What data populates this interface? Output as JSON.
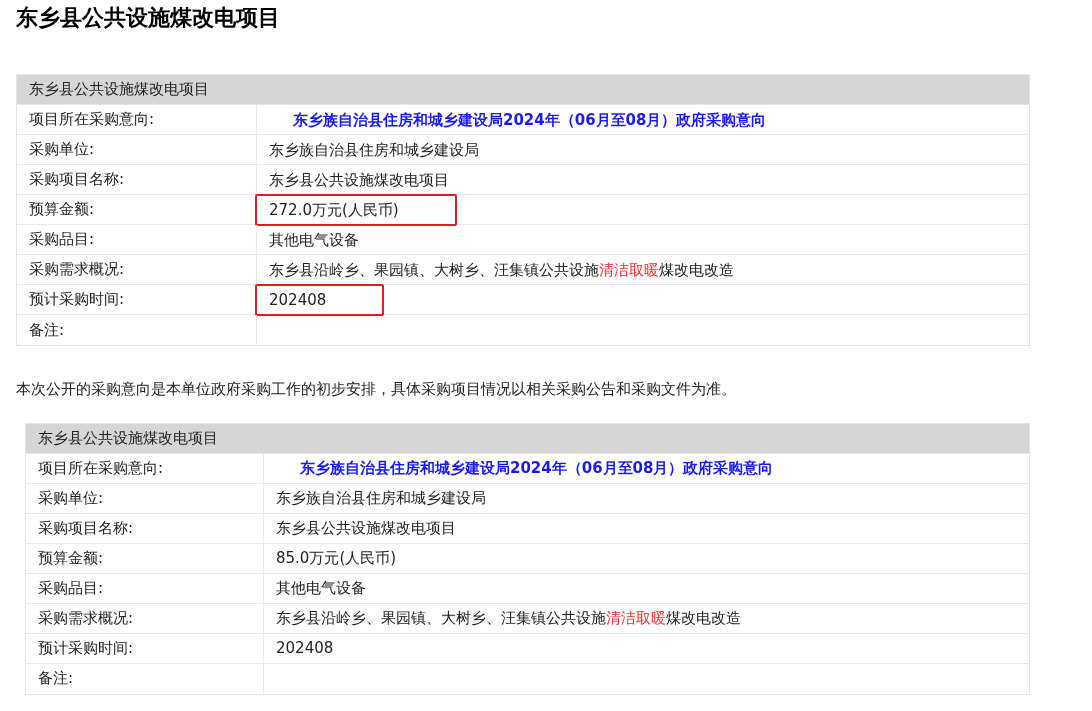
{
  "page_title": "东乡县公共设施煤改电项目",
  "tables": [
    {
      "caption": "东乡县公共设施煤改电项目",
      "rows": [
        {
          "label": "项目所在采购意向:",
          "kind": "link",
          "marked": false,
          "parts": [
            {
              "text": "东乡族自治县住房和城乡建设局2024年（06月至08月）政府采购意向",
              "emphasis": false
            }
          ]
        },
        {
          "label": "采购单位:",
          "kind": "text",
          "marked": false,
          "parts": [
            {
              "text": "东乡族自治县住房和城乡建设局",
              "emphasis": false
            }
          ]
        },
        {
          "label": "采购项目名称:",
          "kind": "text",
          "marked": false,
          "parts": [
            {
              "text": "东乡县公共设施煤改电项目",
              "emphasis": false
            }
          ]
        },
        {
          "label": "预算金额:",
          "kind": "text",
          "marked": true,
          "parts": [
            {
              "text": "272.0万元(人民币)",
              "emphasis": false
            }
          ]
        },
        {
          "label": "采购品目:",
          "kind": "text",
          "marked": false,
          "parts": [
            {
              "text": "其他电气设备",
              "emphasis": false
            }
          ]
        },
        {
          "label": "采购需求概况:",
          "kind": "text",
          "marked": false,
          "parts": [
            {
              "text": "东乡县沿岭乡、果园镇、大树乡、汪集镇公共设施",
              "emphasis": false
            },
            {
              "text": "清洁取暖",
              "emphasis": true
            },
            {
              "text": "煤改电改造",
              "emphasis": false
            }
          ]
        },
        {
          "label": "预计采购时间:",
          "kind": "text",
          "marked": true,
          "parts": [
            {
              "text": "202408",
              "emphasis": false
            }
          ]
        },
        {
          "label": "备注:",
          "kind": "text",
          "marked": false,
          "parts": []
        }
      ]
    },
    {
      "caption": "东乡县公共设施煤改电项目",
      "rows": [
        {
          "label": "项目所在采购意向:",
          "kind": "link",
          "marked": false,
          "parts": [
            {
              "text": "东乡族自治县住房和城乡建设局2024年（06月至08月）政府采购意向",
              "emphasis": false
            }
          ]
        },
        {
          "label": "采购单位:",
          "kind": "text",
          "marked": false,
          "parts": [
            {
              "text": "东乡族自治县住房和城乡建设局",
              "emphasis": false
            }
          ]
        },
        {
          "label": "采购项目名称:",
          "kind": "text",
          "marked": false,
          "parts": [
            {
              "text": "东乡县公共设施煤改电项目",
              "emphasis": false
            }
          ]
        },
        {
          "label": "预算金额:",
          "kind": "text",
          "marked": false,
          "parts": [
            {
              "text": "85.0万元(人民币)",
              "emphasis": false
            }
          ]
        },
        {
          "label": "采购品目:",
          "kind": "text",
          "marked": false,
          "parts": [
            {
              "text": "其他电气设备",
              "emphasis": false
            }
          ]
        },
        {
          "label": "采购需求概况:",
          "kind": "text",
          "marked": false,
          "parts": [
            {
              "text": "东乡县沿岭乡、果园镇、大树乡、汪集镇公共设施",
              "emphasis": false
            },
            {
              "text": "清洁取暖",
              "emphasis": true
            },
            {
              "text": "煤改电改造",
              "emphasis": false
            }
          ]
        },
        {
          "label": "预计采购时间:",
          "kind": "text",
          "marked": false,
          "parts": [
            {
              "text": "202408",
              "emphasis": false
            }
          ]
        },
        {
          "label": "备注:",
          "kind": "text",
          "marked": false,
          "parts": []
        }
      ]
    }
  ],
  "note": "本次公开的采购意向是本单位政府采购工作的初步安排，具体采购项目情况以相关采购公告和采购文件为准。"
}
